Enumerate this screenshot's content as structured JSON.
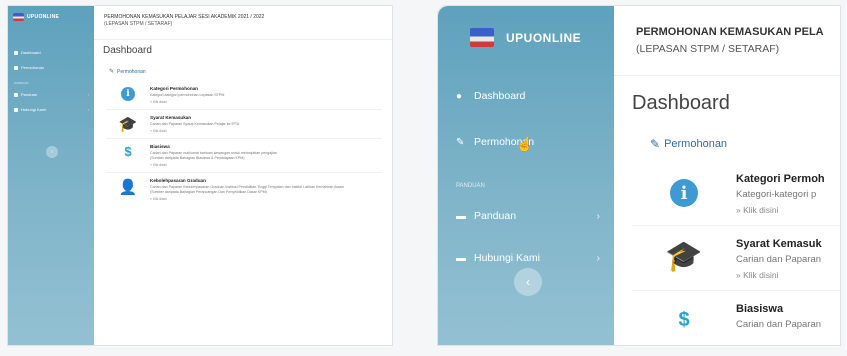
{
  "app": {
    "brand": "UPUONLINE",
    "title": "PERMOHONAN KEMASUKAN PELAJAR SESI AKADEMIK 2021 / 2022",
    "title_zoomed": "PERMOHONAN KEMASUKAN PELA",
    "subtitle": "(LEPASAN STPM / SETARAF)"
  },
  "sidebar": {
    "items": [
      {
        "label": "Dashboard",
        "icon": "palette-icon"
      },
      {
        "label": "Permohonan",
        "icon": "edit-icon"
      }
    ],
    "section_label": "PANDUAN",
    "more_items": [
      {
        "label": "Panduan",
        "icon": "folder-icon"
      },
      {
        "label": "Hubungi Kami",
        "icon": "folder-icon"
      }
    ],
    "collapse_symbol": "‹"
  },
  "main": {
    "page_title": "Dashboard",
    "section_title": "Permohonan",
    "items": [
      {
        "title": "Kategori Permohonan",
        "title_zoomed": "Kategori Permoh",
        "desc": "Kategori-kategori permohonan Lepasan STPM",
        "desc_zoomed": "Kategori-kategori p",
        "link": "» Klik disini"
      },
      {
        "title": "Syarat Kemasukan",
        "title_zoomed": "Syarat Kemasuk",
        "desc": "Carian dan Paparan Syarat Kemasukan Pelajar ke IPTA",
        "desc_zoomed": "Carian dan Paparan",
        "link": "» Klik disini"
      },
      {
        "title": "Biasiswa",
        "title_zoomed": "Biasiswa",
        "desc": "Carian dan Paparan maklumat bantuan kewangan untuk melanjutkan pengajian",
        "desc2": "(Sumber daripada Bahagian Biasiswa & Pembiayaan KPM)",
        "desc_zoomed": "Carian dan Paparan",
        "link": "» Klik disini"
      },
      {
        "title": "Kebolehpasaran Graduan",
        "desc": "Carian dan Paparan Kebolehpasaran Graduan Institusi Pendidikan Tinggi Tempatan dan Institut Latihan Kemahiran Awam",
        "desc2": "(Sumber daripada Bahagian Perancangan Dan Penyelidikan Dasar KPM)",
        "link": "» Klik disini"
      }
    ]
  },
  "colors": {
    "sidebar_top": "#5ea1bd",
    "sidebar_bottom": "#93c1d3",
    "accent": "#2e6da4",
    "info_icon": "#3f9ad3"
  }
}
